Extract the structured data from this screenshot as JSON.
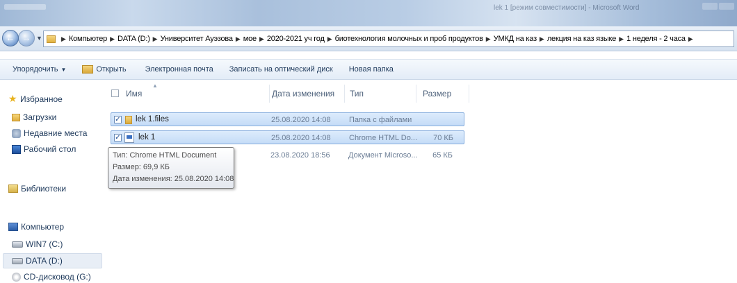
{
  "window": {
    "title": "lek 1 [режим совместимости] - Microsoft Word"
  },
  "address": {
    "crumbs": [
      "Компьютер",
      "DATA (D:)",
      "Университет Ауэзова",
      "мое",
      "2020-2021 уч год",
      "биотехнология молочных и проб продуктов",
      "УМКД на каз",
      "лекция на каз языке",
      "1 неделя - 2 часа"
    ]
  },
  "toolbar": {
    "organize": "Упорядочить",
    "open": "Открыть",
    "email": "Электронная почта",
    "burn": "Записать на оптический диск",
    "new_folder": "Новая папка"
  },
  "nav": {
    "favorites": "Избранное",
    "downloads": "Загрузки",
    "recent": "Недавние места",
    "desktop": "Рабочий стол",
    "libraries": "Библиотеки",
    "computer": "Компьютер",
    "drive_c": "WIN7 (C:)",
    "drive_d": "DATA (D:)",
    "drive_g": "CD-дисковод (G:)"
  },
  "columns": {
    "name": "Имя",
    "date": "Дата изменения",
    "type": "Тип",
    "size": "Размер"
  },
  "files": [
    {
      "name": "lek 1.files",
      "date": "25.08.2020 14:08",
      "type": "Папка с файлами",
      "size": ""
    },
    {
      "name": "lek 1",
      "date": "25.08.2020 14:08",
      "type": "Chrome HTML Do...",
      "size": "70 КБ"
    },
    {
      "name": "",
      "date": "23.08.2020 18:56",
      "type": "Документ Microso...",
      "size": "65 КБ"
    }
  ],
  "tooltip": {
    "type": "Тип: Chrome HTML Document",
    "size": "Размер: 69,9 КБ",
    "modified": "Дата изменения: 25.08.2020 14:08"
  }
}
